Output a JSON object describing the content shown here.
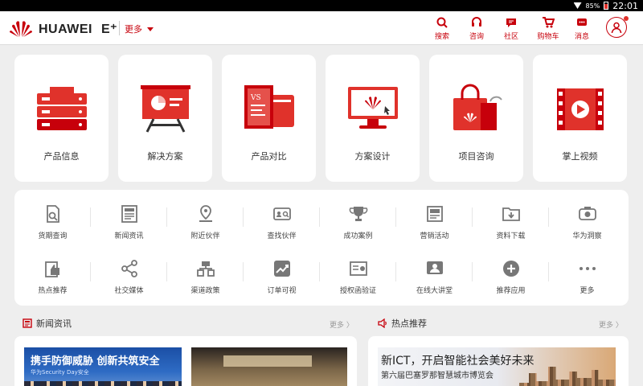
{
  "status_bar": {
    "battery": "85%",
    "time": "22:01"
  },
  "header": {
    "brand": "HUAWEI",
    "brand_suffix": "E⁺",
    "more_label": "更多",
    "nav": [
      {
        "label": "搜索",
        "icon": "search-icon"
      },
      {
        "label": "咨询",
        "icon": "headset-icon"
      },
      {
        "label": "社区",
        "icon": "chat-icon"
      },
      {
        "label": "购物车",
        "icon": "cart-icon"
      },
      {
        "label": "消息",
        "icon": "message-icon"
      }
    ]
  },
  "cards": [
    {
      "label": "产品信息",
      "icon": "server-icon"
    },
    {
      "label": "解决方案",
      "icon": "presentation-icon"
    },
    {
      "label": "产品对比",
      "icon": "compare-icon"
    },
    {
      "label": "方案设计",
      "icon": "monitor-icon"
    },
    {
      "label": "项目咨询",
      "icon": "shopping-bag-icon"
    },
    {
      "label": "掌上视频",
      "icon": "video-icon"
    }
  ],
  "grid": [
    {
      "label": "货期查询",
      "icon": "document-search-icon"
    },
    {
      "label": "新闻资讯",
      "icon": "newspaper-icon"
    },
    {
      "label": "附近伙伴",
      "icon": "location-pin-icon"
    },
    {
      "label": "查找伙伴",
      "icon": "id-card-search-icon"
    },
    {
      "label": "成功案例",
      "icon": "trophy-icon"
    },
    {
      "label": "营销活动",
      "icon": "poster-icon"
    },
    {
      "label": "资料下载",
      "icon": "folder-download-icon"
    },
    {
      "label": "华为洞察",
      "icon": "eye-icon"
    },
    {
      "label": "热点推荐",
      "icon": "thumbs-up-icon"
    },
    {
      "label": "社交媒体",
      "icon": "share-icon"
    },
    {
      "label": "渠道政策",
      "icon": "channel-icon"
    },
    {
      "label": "订单可视",
      "icon": "chart-icon"
    },
    {
      "label": "授权函验证",
      "icon": "certificate-icon"
    },
    {
      "label": "在线大讲堂",
      "icon": "lecture-icon"
    },
    {
      "label": "推荐应用",
      "icon": "plus-circle-icon"
    },
    {
      "label": "更多",
      "icon": "more-dots-icon"
    }
  ],
  "news": {
    "title": "新闻资讯",
    "more": "更多 〉",
    "item1_headline": "携手防御威胁 创新共筑安全",
    "item1_sub": "华为Security Day安全"
  },
  "hot": {
    "title": "热点推荐",
    "more": "更多 〉",
    "headline": "新ICT，开启智能社会美好未来",
    "sub": "第六届巴塞罗那智慧城市博览会"
  },
  "colors": {
    "brand_red": "#c7000b",
    "illustration_red": "#e0322b"
  }
}
